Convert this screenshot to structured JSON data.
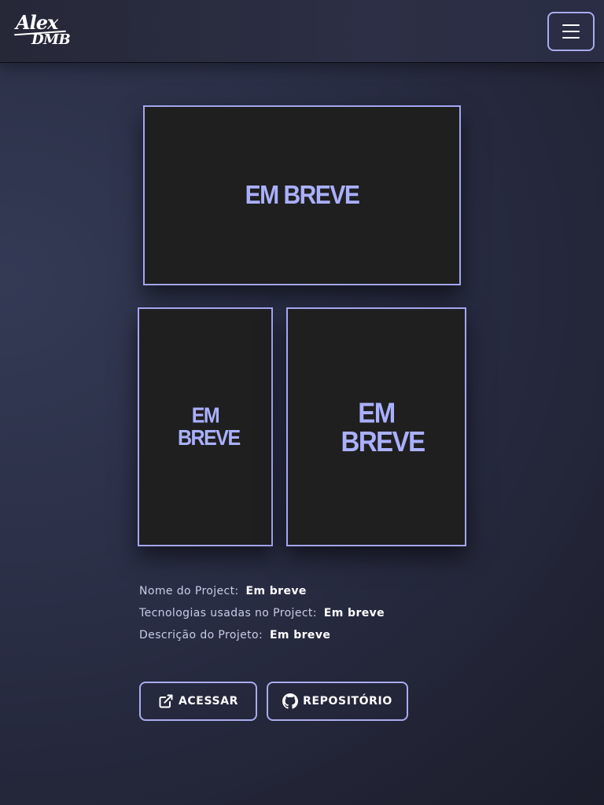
{
  "header": {
    "logo_line1": "Alex",
    "logo_line2": "DMB",
    "menu_icon": "hamburger-icon"
  },
  "gallery": {
    "placeholders": [
      "EM BREVE",
      "EM BREVE",
      "EM BREVE"
    ]
  },
  "project": {
    "name_label": "Nome do Project:",
    "name_value": "Em breve",
    "tech_label": "Tecnologias usadas no Project:",
    "tech_value": "Em breve",
    "desc_label": "Descrição do Projeto:",
    "desc_value": "Em breve"
  },
  "actions": {
    "access_label": "ACESSAR",
    "access_icon": "external-link-icon",
    "repo_label": "REPOSITÓRIO",
    "repo_icon": "github-icon"
  },
  "colors": {
    "accent": "#a9abee",
    "placeholder_text": "#aab0ff",
    "background": "#2a2e45",
    "frame_fill": "#1f1f1f"
  }
}
